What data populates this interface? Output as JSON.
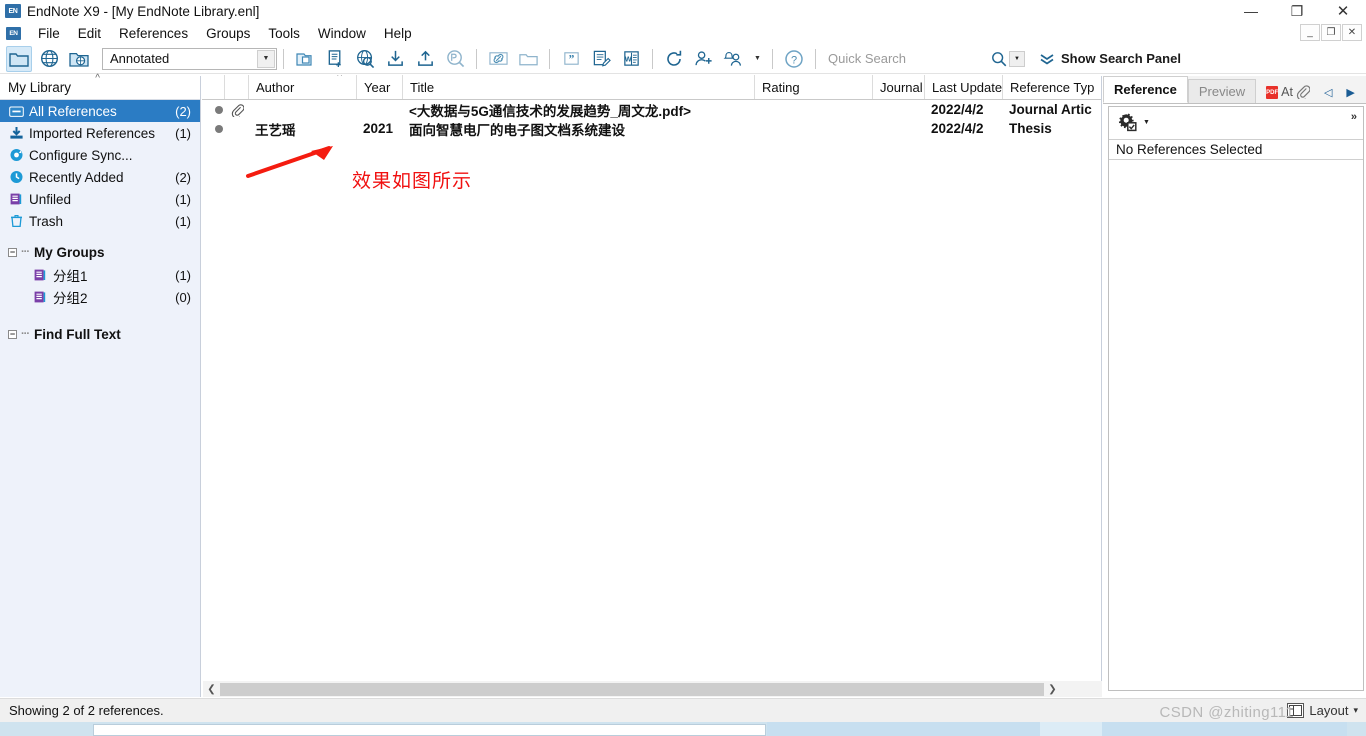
{
  "window": {
    "title": "EndNote X9 - [My EndNote Library.enl]",
    "app_badge": "EN",
    "minimize": "—",
    "maximize": "❐",
    "close": "✕",
    "mdi_minimize": "_",
    "mdi_restore": "❐",
    "mdi_close": "✕"
  },
  "menu": {
    "items": [
      {
        "label": "File"
      },
      {
        "label": "Edit"
      },
      {
        "label": "References"
      },
      {
        "label": "Groups"
      },
      {
        "label": "Tools"
      },
      {
        "label": "Window"
      },
      {
        "label": "Help"
      }
    ]
  },
  "toolbar": {
    "style_value": "Annotated",
    "quick_search_placeholder": "Quick Search",
    "show_search_panel": "Show Search Panel",
    "icons": [
      "open-library-icon",
      "online-search-icon",
      "local-online-mode-icon",
      "copy-references-icon",
      "new-reference-icon",
      "online-search-ref-icon",
      "import-icon",
      "export-icon",
      "find-full-text-icon",
      "open-link-icon",
      "open-file-icon",
      "insert-citation-icon",
      "format-paper-icon",
      "word-icon",
      "sync-icon",
      "share-library-icon",
      "notifications-icon",
      "help-icon"
    ]
  },
  "sidebar": {
    "header": "My Library",
    "items": [
      {
        "label": "All References",
        "count": "(2)",
        "icon": "library-icon",
        "selected": true
      },
      {
        "label": "Imported References",
        "count": "(1)",
        "icon": "import-icon",
        "selected": false
      },
      {
        "label": "Configure Sync...",
        "count": "",
        "icon": "sync-icon",
        "selected": false
      },
      {
        "label": "Recently Added",
        "count": "(2)",
        "icon": "clock-icon",
        "selected": false
      },
      {
        "label": "Unfiled",
        "count": "(1)",
        "icon": "unfiled-icon",
        "selected": false
      },
      {
        "label": "Trash",
        "count": "(1)",
        "icon": "trash-icon",
        "selected": false
      }
    ],
    "my_groups": {
      "label": "My Groups",
      "expander": "−",
      "items": [
        {
          "label": "分组1",
          "count": "(1)",
          "icon": "group-icon"
        },
        {
          "label": "分组2",
          "count": "(0)",
          "icon": "group-icon"
        }
      ]
    },
    "find_full_text": {
      "label": "Find Full Text",
      "expander": "−"
    }
  },
  "reference_list": {
    "columns": [
      {
        "key": "dot",
        "label": ""
      },
      {
        "key": "clip",
        "label": ""
      },
      {
        "key": "author",
        "label": "Author"
      },
      {
        "key": "year",
        "label": "Year"
      },
      {
        "key": "title",
        "label": "Title"
      },
      {
        "key": "rating",
        "label": "Rating"
      },
      {
        "key": "journal",
        "label": "Journal"
      },
      {
        "key": "updated",
        "label": "Last Updated"
      },
      {
        "key": "type",
        "label": "Reference Typ"
      }
    ],
    "sort_column": "author",
    "sort_caret": "^",
    "rows": [
      {
        "dot": "●",
        "clip": "paperclip-icon",
        "author": "",
        "year": "",
        "title": "<大数据与5G通信技术的发展趋势_周文龙.pdf>",
        "rating": "",
        "journal": "",
        "updated": "2022/4/2",
        "type": "Journal Artic"
      },
      {
        "dot": "●",
        "clip": "",
        "author": "王艺瑶",
        "year": "2021",
        "title": "面向智慧电厂的电子图文档系统建设",
        "rating": "",
        "journal": "",
        "updated": "2022/4/2",
        "type": "Thesis"
      }
    ]
  },
  "right_panel": {
    "tabs": [
      {
        "label": "Reference",
        "active": true
      },
      {
        "label": "Preview",
        "active": false
      }
    ],
    "pdf_badge": "PDF",
    "attach_label": "At",
    "nav_prev": "◁",
    "nav_next": "▶",
    "nav_menu": "▼",
    "expand_chevron": "»",
    "gear_icon": "settings-gear-icon",
    "empty_message": "No References Selected"
  },
  "status": {
    "text": "Showing 2 of 2 references.",
    "layout_label": "Layout",
    "layout_caret": "▾"
  },
  "annotation": {
    "text": "效果如图所示",
    "color": "#f01010"
  },
  "watermark": {
    "text": "CSDN @zhiting111"
  },
  "colors": {
    "selection_blue": "#2b7cc4",
    "toolbar_icon_blue": "#1f6591",
    "sidebar_bg": "#eef2fa",
    "annotation_red": "#f01010"
  }
}
